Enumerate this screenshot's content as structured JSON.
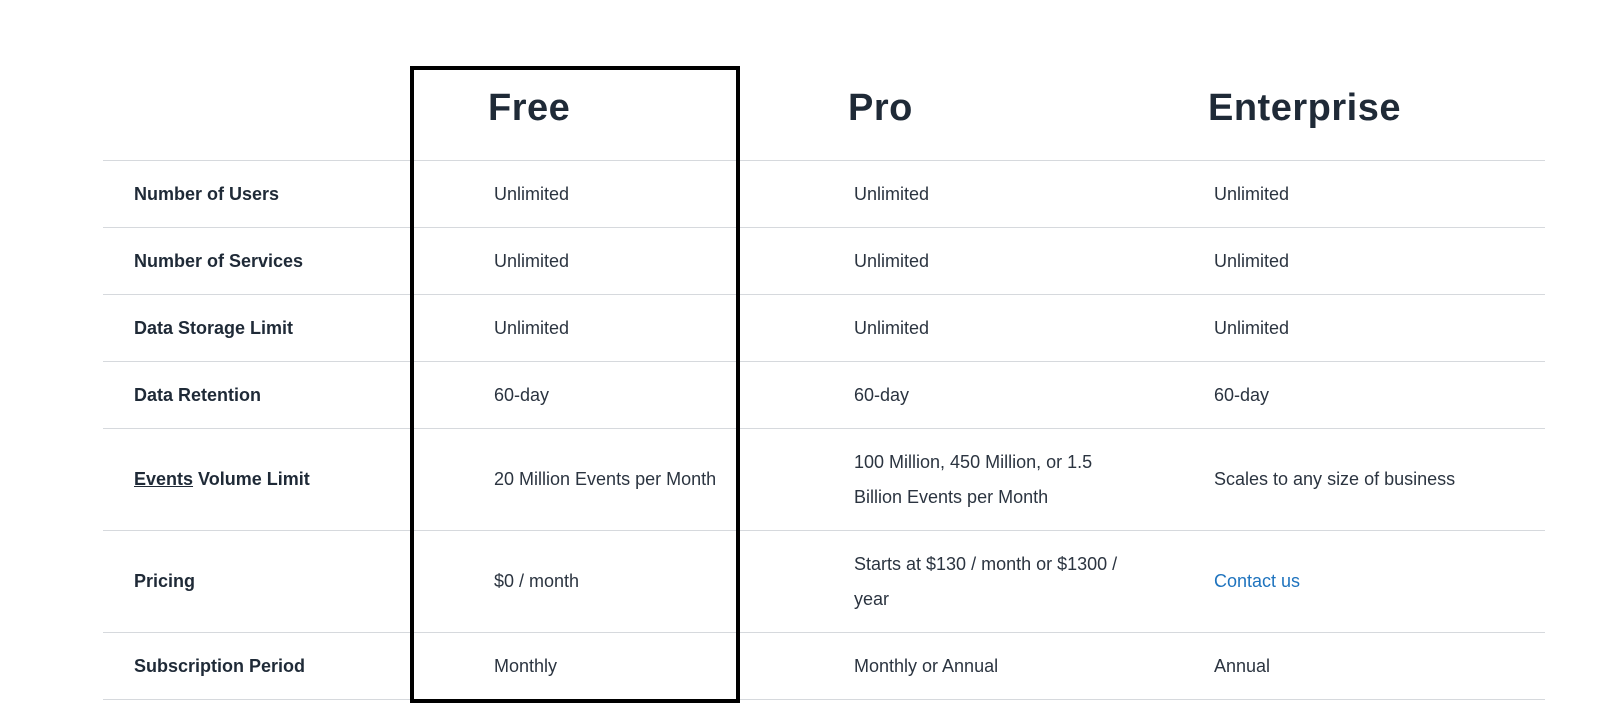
{
  "plans": {
    "free": "Free",
    "pro": "Pro",
    "enterprise": "Enterprise"
  },
  "rows": [
    {
      "label": "Number of Users",
      "free": "Unlimited",
      "pro": "Unlimited",
      "enterprise": "Unlimited"
    },
    {
      "label": "Number of Services",
      "free": "Unlimited",
      "pro": "Unlimited",
      "enterprise": "Unlimited"
    },
    {
      "label": "Data Storage Limit",
      "free": "Unlimited",
      "pro": "Unlimited",
      "enterprise": "Unlimited"
    },
    {
      "label": "Data Retention",
      "free": "60-day",
      "pro": "60-day",
      "enterprise": "60-day"
    },
    {
      "label_link": "Events",
      "label_rest": " Volume Limit",
      "free": "20 Million Events per Month",
      "pro": "100 Million, 450 Million, or 1.5 Billion Events per Month",
      "enterprise": "Scales to any size of business"
    },
    {
      "label": "Pricing",
      "free": "$0 / month",
      "pro": "Starts at $130 / month or $1300 / year",
      "enterprise": "Contact us"
    },
    {
      "label": "Subscription Period",
      "free": "Monthly",
      "pro": "Monthly or Annual",
      "enterprise": "Annual"
    }
  ],
  "colors": {
    "text": "#1f2a37",
    "link": "#1e73be",
    "divider": "#d6d9dd",
    "highlight_border": "#000000"
  }
}
